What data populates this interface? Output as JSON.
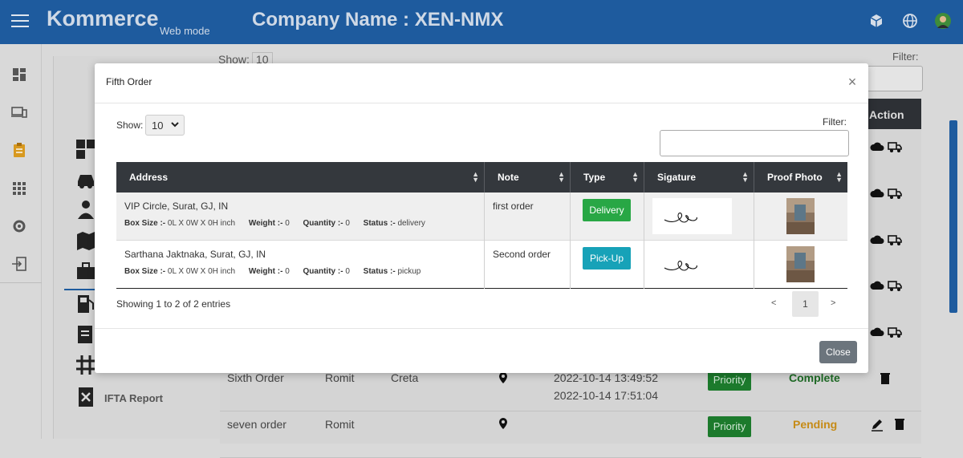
{
  "topbar": {
    "brand": "Kommerce",
    "mode": "Web mode",
    "company": "Company Name : XEN-NMX",
    "icons": [
      "menu-icon",
      "cube-icon",
      "globe-icon",
      "avatar"
    ]
  },
  "rail": {
    "icons": [
      "dashboard-icon",
      "devices-icon",
      "clipboard-icon",
      "apps-grid-icon",
      "gear-icon",
      "logout-icon"
    ]
  },
  "submenu": {
    "ifta_label": "IFTA Report"
  },
  "background": {
    "show_label": "Show:",
    "show_value": "10",
    "filter_label": "Filter:",
    "action_header": "Action",
    "rows": [
      {
        "order": "Sixth Order",
        "driver": "Romit",
        "vehicle": "Creta",
        "date1": "2022-10-14 13:49:52",
        "date2": "2022-10-14 17:51:04",
        "priority": "Priority",
        "status": "Complete"
      },
      {
        "order": "seven order",
        "driver": "Romit",
        "vehicle": "",
        "date1": "",
        "date2": "",
        "priority": "Priority",
        "status": "Pending"
      }
    ]
  },
  "modal": {
    "title": "Fifth Order",
    "close_symbol": "×",
    "show_label": "Show:",
    "show_value": "10",
    "filter_label": "Filter:",
    "filter_value": "",
    "columns": [
      "Address",
      "Note",
      "Type",
      "Sigature",
      "Proof Photo"
    ],
    "rows": [
      {
        "address": "VIP Circle, Surat, GJ, IN",
        "box_size_label": "Box Size :-",
        "box_size": "0L X 0W X 0H inch",
        "weight_label": "Weight :-",
        "weight": "0",
        "quantity_label": "Quantity :-",
        "quantity": "0",
        "status_label": "Status :-",
        "status": "delivery",
        "note": "first order",
        "type": "Delivery",
        "type_color": "#28a745"
      },
      {
        "address": "Sarthana Jaktnaka, Surat, GJ, IN",
        "box_size_label": "Box Size :-",
        "box_size": "0L X 0W X 0H inch",
        "weight_label": "Weight :-",
        "weight": "0",
        "quantity_label": "Quantity :-",
        "quantity": "0",
        "status_label": "Status :-",
        "status": "pickup",
        "note": "Second order",
        "type": "Pick-Up",
        "type_color": "#17a2b8"
      }
    ],
    "info": "Showing 1 to 2 of 2 entries",
    "pagination": {
      "prev": "<",
      "current": "1",
      "next": ">"
    },
    "close_label": "Close"
  }
}
